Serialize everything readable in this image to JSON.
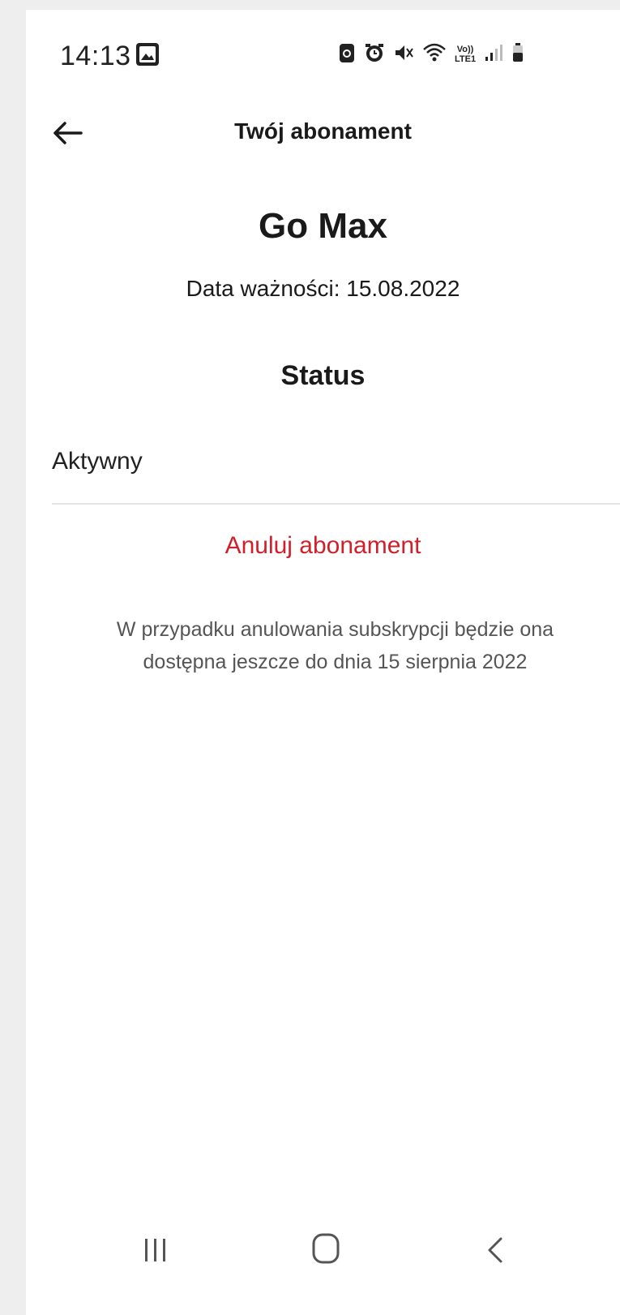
{
  "status_bar": {
    "time": "14:13",
    "icons": [
      "gallery-icon",
      "battery-saver-icon",
      "alarm-icon",
      "mute-icon",
      "wifi-icon",
      "volte-icon",
      "signal-icon",
      "battery-icon"
    ],
    "volte_label": "Vo))",
    "lte_label": "LTE1"
  },
  "header": {
    "title": "Twój abonament"
  },
  "subscription": {
    "plan_name": "Go Max",
    "expiry": "Data ważności: 15.08.2022",
    "status_heading": "Status",
    "status_value": "Aktywny",
    "cancel_label": "Anuluj abonament",
    "cancel_info": "W przypadku anulowania subskrypcji będzie ona dostępna jeszcze do dnia 15 sierpnia 2022"
  },
  "colors": {
    "accent_red": "#d0202a",
    "text": "#1a1a1a",
    "muted": "#555555"
  }
}
